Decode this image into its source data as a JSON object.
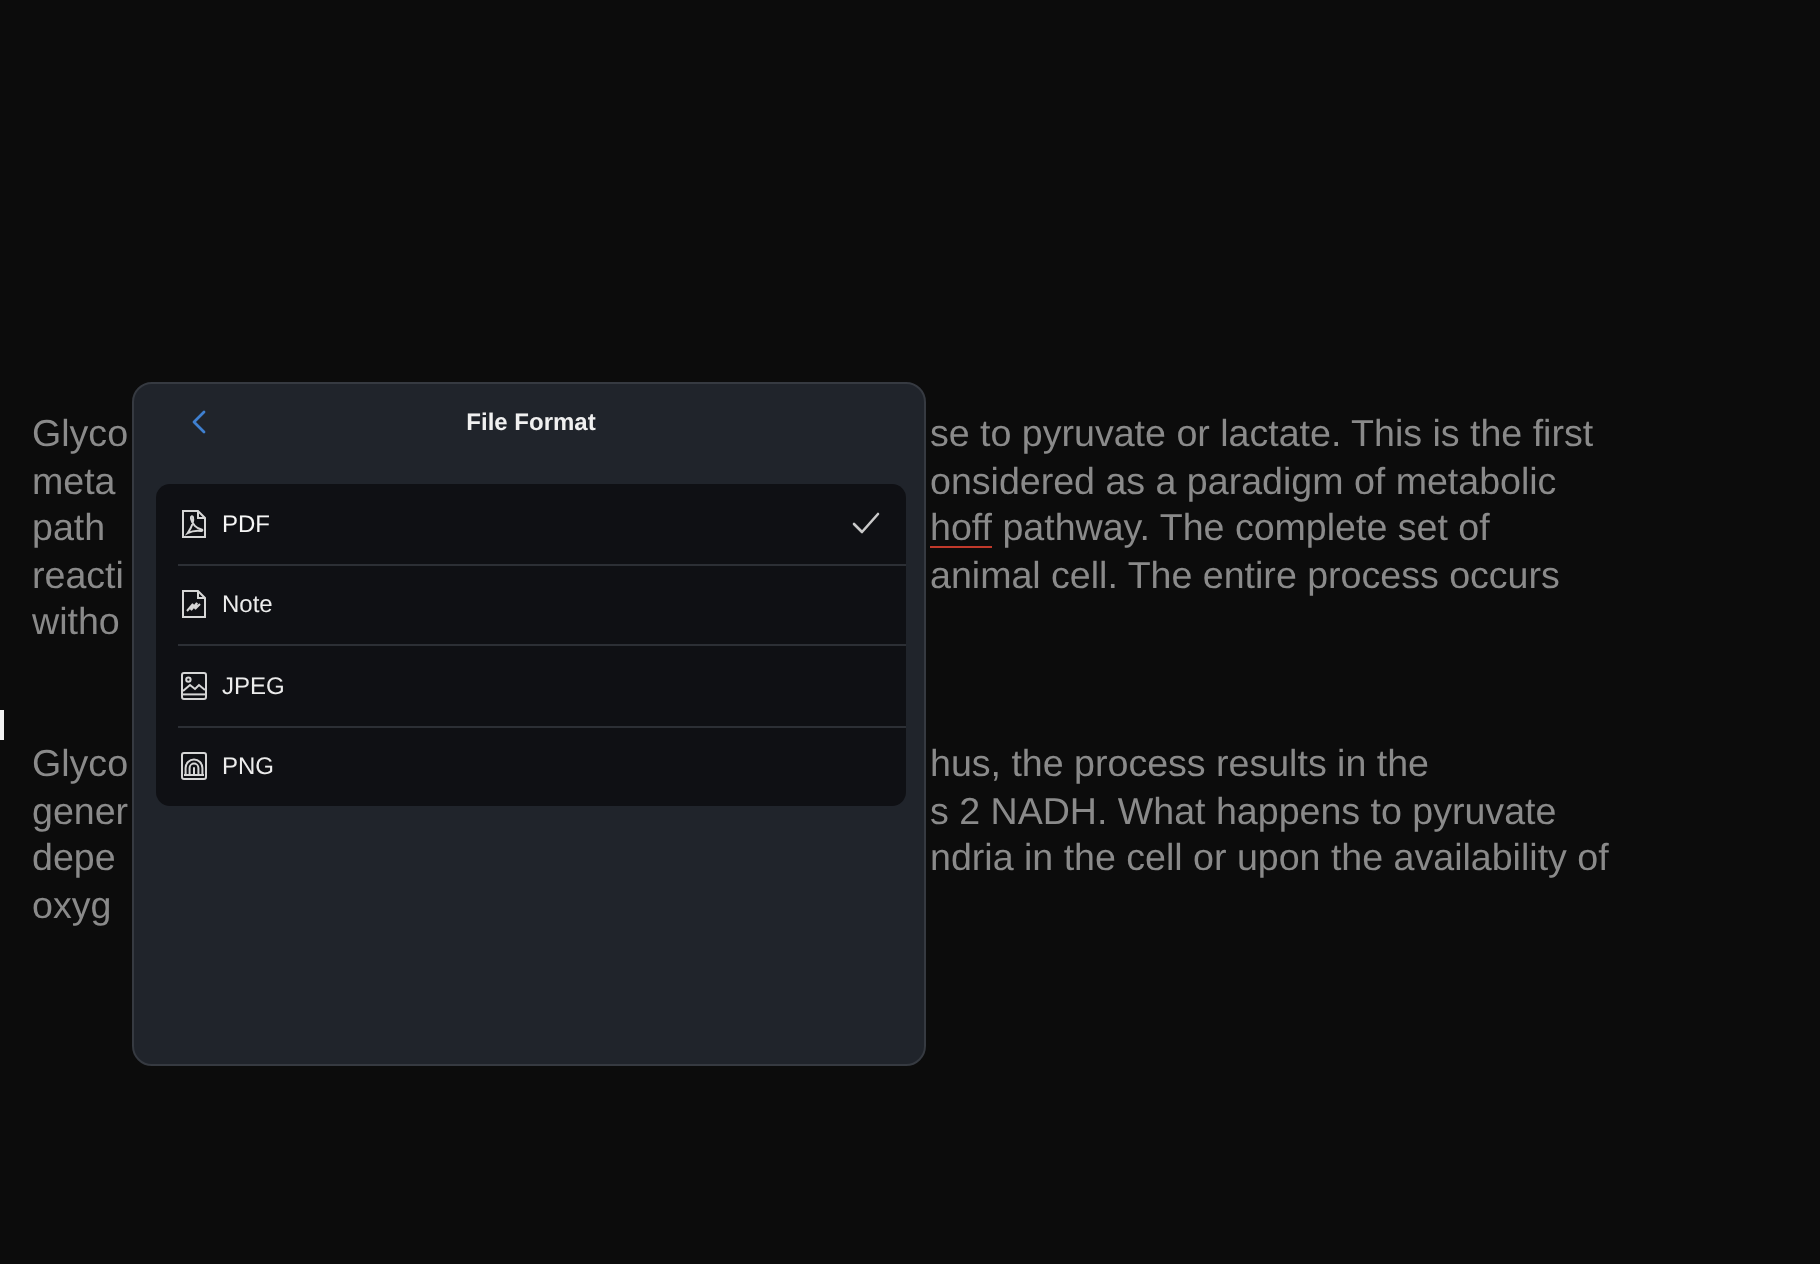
{
  "document": {
    "paragraphs": [
      {
        "lines": [
          {
            "left": "Glyco",
            "right": [
              {
                "text": "se to pyruvate or lactate. This is the first",
                "flagged": false
              }
            ]
          },
          {
            "left": "meta",
            "right": [
              {
                "text": "onsidered as a paradigm of metabolic",
                "flagged": false
              }
            ]
          },
          {
            "left": "path",
            "right": [
              {
                "text": "hoff",
                "flagged": true
              },
              {
                "text": " pathway. The complete set of",
                "flagged": false
              }
            ]
          },
          {
            "left": "reacti",
            "right": [
              {
                "text": "animal cell. The entire process occurs",
                "flagged": false
              }
            ]
          },
          {
            "left": "witho"
          }
        ]
      },
      {
        "lines": [
          {
            "left": "Glyco",
            "right": [
              {
                "text": "hus, the process results in the",
                "flagged": false
              }
            ]
          },
          {
            "left": "gener",
            "right": [
              {
                "text": "s 2 NADH. What happens to pyruvate",
                "flagged": false
              }
            ]
          },
          {
            "left": "depe",
            "right": [
              {
                "text": "ndria in the cell or upon the availability of",
                "flagged": false
              }
            ]
          },
          {
            "left": "oxyg"
          }
        ]
      }
    ]
  },
  "dialog": {
    "title": "File Format",
    "formats": [
      {
        "kind": "pdf",
        "label": "PDF",
        "selected": true
      },
      {
        "kind": "note",
        "label": "Note",
        "selected": false
      },
      {
        "kind": "jpeg",
        "label": "JPEG",
        "selected": false
      },
      {
        "kind": "png",
        "label": "PNG",
        "selected": false
      }
    ]
  }
}
